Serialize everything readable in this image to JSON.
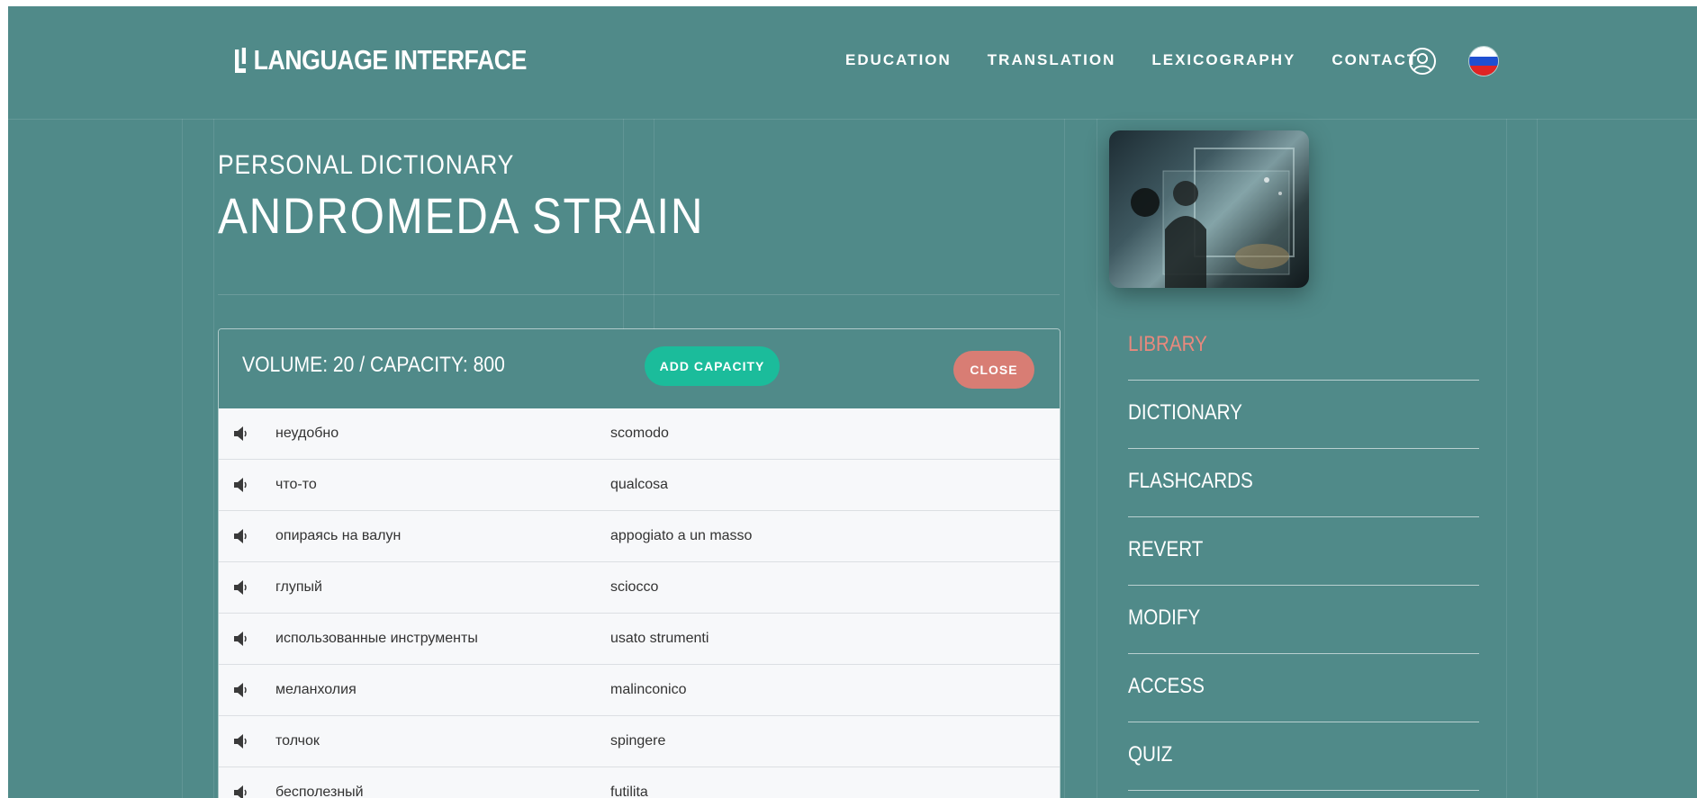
{
  "header": {
    "logo_text": "LANGUAGE INTERFACE",
    "nav": [
      "EDUCATION",
      "TRANSLATION",
      "LEXICOGRAPHY",
      "CONTACT"
    ],
    "user_icon": "user-circle-icon",
    "flag_icon": "russian-flag-icon"
  },
  "page": {
    "subtitle": "PERSONAL DICTIONARY",
    "title": "ANDROMEDA STRAIN"
  },
  "panel": {
    "volume_text": "VOLUME: 20 / CAPACITY: 800",
    "add_capacity_label": "ADD CAPACITY",
    "close_label": "CLOSE",
    "rows": [
      {
        "ru": "неудобно",
        "it": "scomodo"
      },
      {
        "ru": "что-то",
        "it": "qualcosa"
      },
      {
        "ru": "опираясь на валун",
        "it": "appogiato a un masso"
      },
      {
        "ru": "глупый",
        "it": "sciocco"
      },
      {
        "ru": "использованные инструменты",
        "it": "usato strumenti"
      },
      {
        "ru": "меланхолия",
        "it": "malinconico"
      },
      {
        "ru": "толчок",
        "it": "spingere"
      },
      {
        "ru": "бесполезный",
        "it": "futilita"
      }
    ]
  },
  "sidebar": {
    "items": [
      "LIBRARY",
      "DICTIONARY",
      "FLASHCARDS",
      "REVERT",
      "MODIFY",
      "ACCESS",
      "QUIZ"
    ],
    "active_index": 0
  },
  "colors": {
    "background": "#508a89",
    "add_button": "#1bbc9b",
    "close_button": "#d87d74",
    "active_menu": "#e8897d"
  }
}
